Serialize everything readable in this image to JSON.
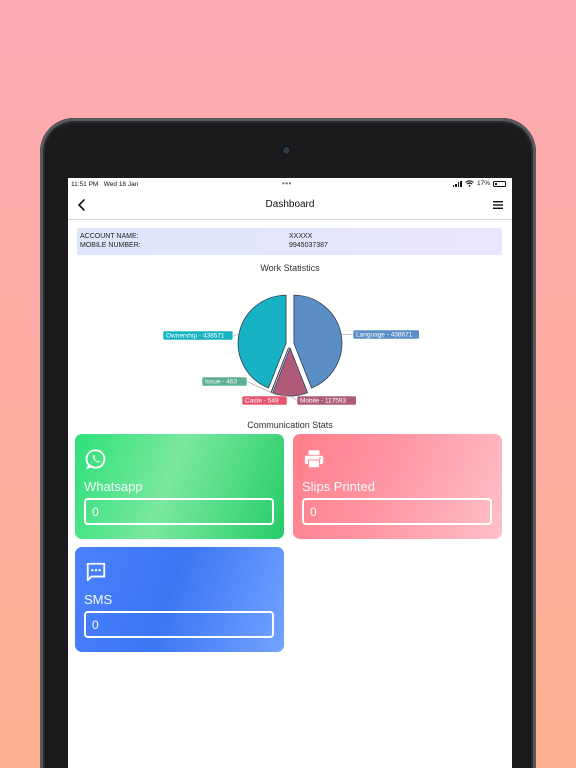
{
  "status_bar": {
    "time": "11:51 PM",
    "date": "Wed 18 Jan",
    "dots": "•••",
    "battery": "17%"
  },
  "nav": {
    "title": "Dashboard",
    "back_icon": "chevron-left-icon",
    "menu_icon": "hamburger-menu-icon"
  },
  "account": {
    "name_label": "ACCOUNT NAME:",
    "name_value": "XXXXX",
    "mobile_label": "MOBILE NUMBER:",
    "mobile_value": "9945037387"
  },
  "work_stats": {
    "title": "Work Statistics"
  },
  "chart_data": {
    "type": "pie",
    "title": "Work Statistics",
    "series": [
      {
        "name": "Language",
        "value": 438671,
        "label": "Language - 438671",
        "color": "#5b8ec5"
      },
      {
        "name": "Mobile",
        "value": 117593,
        "label": "Mobile - 117593",
        "color": "#b05a7a"
      },
      {
        "name": "Caste",
        "value": 549,
        "label": "Caste - 549",
        "color": "#e8566e"
      },
      {
        "name": "Issue",
        "value": 463,
        "label": "Issue - 463",
        "color": "#5cae95"
      },
      {
        "name": "Ownership",
        "value": 438571,
        "label": "Ownership - 438571",
        "color": "#17b3c4"
      }
    ],
    "legend_placement": "callout labels"
  },
  "comm_stats": {
    "title": "Communication Stats",
    "cards": [
      {
        "label": "Whatsapp",
        "value": "0",
        "icon": "whatsapp-icon"
      },
      {
        "label": "Slips Printed",
        "value": "0",
        "icon": "printer-icon"
      },
      {
        "label": "SMS",
        "value": "0",
        "icon": "sms-icon"
      }
    ]
  }
}
